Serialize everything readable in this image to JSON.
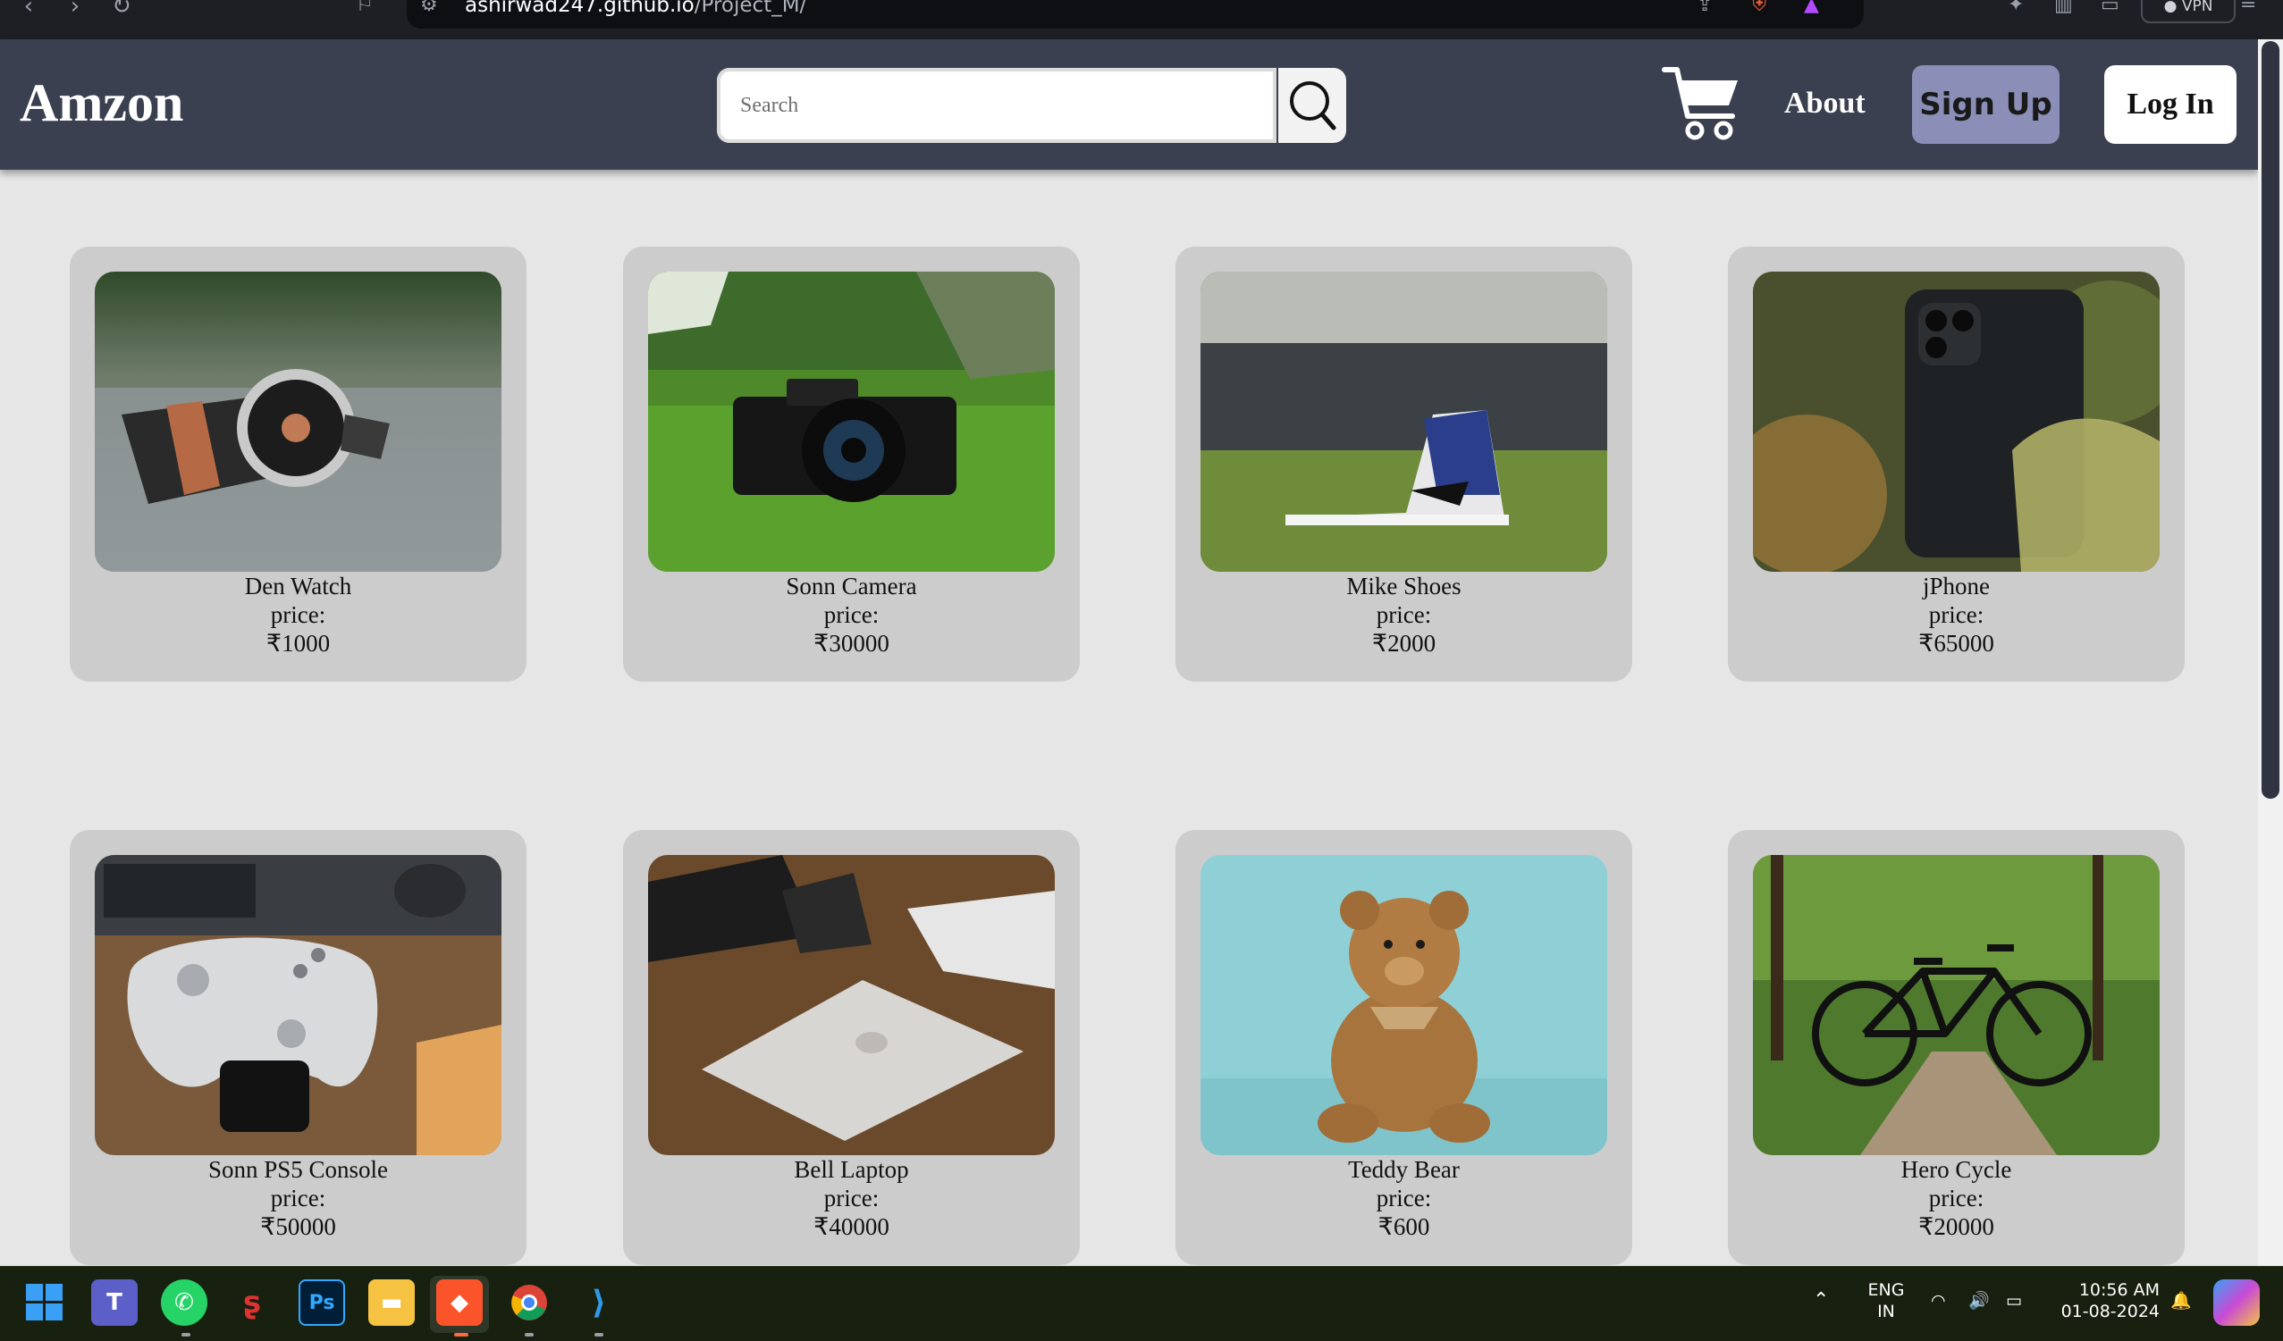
{
  "browser": {
    "url_host": "ashirwad247.github.io",
    "url_path": "/Project_M/",
    "vpn_label": "VPN"
  },
  "header": {
    "logo": "Amzon",
    "search_placeholder": "Search",
    "about_label": "About",
    "signup_label": "Sign Up",
    "login_label": "Log In"
  },
  "products": [
    {
      "name": "Den Watch",
      "price_label": "price:",
      "price": "₹1000"
    },
    {
      "name": "Sonn Camera",
      "price_label": "price:",
      "price": "₹30000"
    },
    {
      "name": "Mike Shoes",
      "price_label": "price:",
      "price": "₹2000"
    },
    {
      "name": "jPhone",
      "price_label": "price:",
      "price": "₹65000"
    },
    {
      "name": "Sonn PS5 Console",
      "price_label": "price:",
      "price": "₹50000"
    },
    {
      "name": "Bell Laptop",
      "price_label": "price:",
      "price": "₹40000"
    },
    {
      "name": "Teddy Bear",
      "price_label": "price:",
      "price": "₹600"
    },
    {
      "name": "Hero Cycle",
      "price_label": "price:",
      "price": "₹20000"
    }
  ],
  "taskbar": {
    "apps": [
      "start-icon",
      "teams-icon",
      "whatsapp-icon",
      "ink-icon",
      "photoshop-icon",
      "file-explorer-icon",
      "brave-icon",
      "chrome-icon",
      "vscode-icon"
    ],
    "photoshop_label": "Ps",
    "language_line1": "ENG",
    "language_line2": "IN",
    "time": "10:56 AM",
    "date": "01-08-2024"
  },
  "colors": {
    "header_bg": "#3a4050",
    "page_bg": "#e6e6e6",
    "card_bg": "#cccccc",
    "signup_bg": "#8b8fb8"
  }
}
